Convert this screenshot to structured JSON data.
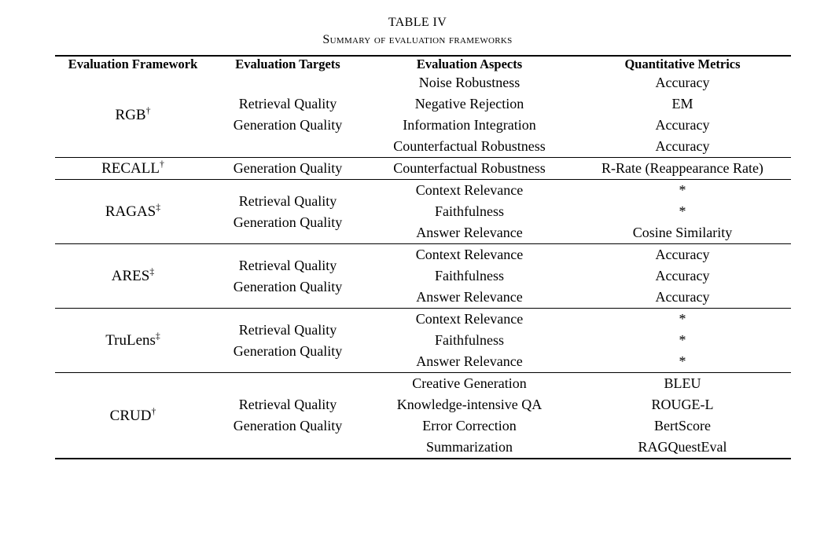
{
  "caption": {
    "label": "TABLE IV",
    "title": "Summary of evaluation frameworks"
  },
  "table": {
    "columns": [
      "Evaluation Framework",
      "Evaluation Targets",
      "Evaluation Aspects",
      "Quantitative Metrics"
    ],
    "rows": [
      {
        "framework": "RGB",
        "marker": "†",
        "targets": [
          "Retrieval Quality",
          "Generation Quality"
        ],
        "aspects": [
          "Noise Robustness",
          "Negative Rejection",
          "Information Integration",
          "Counterfactual Robustness"
        ],
        "metrics": [
          "Accuracy",
          "EM",
          "Accuracy",
          "Accuracy"
        ]
      },
      {
        "framework": "RECALL",
        "marker": "†",
        "targets": [
          "Generation Quality"
        ],
        "aspects": [
          "Counterfactual Robustness"
        ],
        "metrics": [
          "R-Rate (Reappearance Rate)"
        ]
      },
      {
        "framework": "RAGAS",
        "marker": "‡",
        "targets": [
          "Retrieval Quality",
          "Generation Quality"
        ],
        "aspects": [
          "Context Relevance",
          "Faithfulness",
          "Answer Relevance"
        ],
        "metrics": [
          "*",
          "*",
          "Cosine Similarity"
        ]
      },
      {
        "framework": "ARES",
        "marker": "‡",
        "targets": [
          "Retrieval Quality",
          "Generation Quality"
        ],
        "aspects": [
          "Context Relevance",
          "Faithfulness",
          "Answer Relevance"
        ],
        "metrics": [
          "Accuracy",
          "Accuracy",
          "Accuracy"
        ]
      },
      {
        "framework": "TruLens",
        "marker": "‡",
        "targets": [
          "Retrieval Quality",
          "Generation Quality"
        ],
        "aspects": [
          "Context Relevance",
          "Faithfulness",
          "Answer Relevance"
        ],
        "metrics": [
          "*",
          "*",
          "*"
        ]
      },
      {
        "framework": "CRUD",
        "marker": "†",
        "targets": [
          "Retrieval Quality",
          "Generation Quality"
        ],
        "aspects": [
          "Creative Generation",
          "Knowledge-intensive QA",
          "Error Correction",
          "Summarization"
        ],
        "metrics": [
          "BLEU",
          "ROUGE-L",
          "BertScore",
          "RAGQuestEval"
        ]
      }
    ]
  }
}
